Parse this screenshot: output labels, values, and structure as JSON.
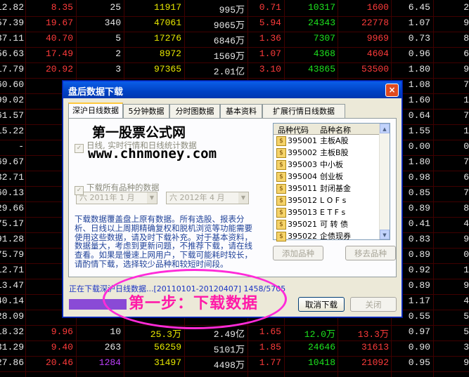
{
  "colors": {
    "red": "#ff3b3b",
    "green": "#1ee31e",
    "yellow": "#e8e800",
    "white": "#e8e8e8",
    "purple": "#c040ff"
  },
  "table_rows": [
    [
      "12.82",
      "8.35",
      "25",
      "11917",
      "995万",
      "0.71",
      "10317",
      "1600",
      "6.45",
      "2"
    ],
    [
      "57.39",
      "19.67",
      "340",
      "47061",
      "9065万",
      "5.94",
      "24343",
      "22778",
      "1.07",
      "9"
    ],
    [
      "37.11",
      "40.70",
      "5",
      "17276",
      "6846万",
      "1.36",
      "7307",
      "9969",
      "0.73",
      "8"
    ],
    [
      "56.63",
      "17.49",
      "2",
      "8972",
      "1569万",
      "1.07",
      "4368",
      "4604",
      "0.96",
      "6"
    ],
    [
      "17.79",
      "20.92",
      "3",
      "97365",
      "2.01亿",
      "3.10",
      "43865",
      "53500",
      "1.80",
      "9"
    ],
    [
      "60.60",
      "",
      "",
      "",
      "",
      "",
      "",
      "",
      "1.08",
      "7"
    ],
    [
      "99.02",
      "",
      "",
      "",
      "",
      "",
      "",
      "",
      "1.60",
      "1"
    ],
    [
      "61.57",
      "",
      "",
      "",
      "",
      "",
      "",
      "",
      "0.64",
      "7"
    ],
    [
      "15.22",
      "",
      "",
      "",
      "",
      "",
      "",
      "",
      "1.55",
      "1"
    ],
    [
      "-",
      "",
      "",
      "",
      "",
      "",
      "",
      "",
      "0.00",
      "0"
    ],
    [
      "69.67",
      "",
      "",
      "",
      "",
      "",
      "",
      "",
      "1.80",
      "7"
    ],
    [
      "32.71",
      "",
      "",
      "",
      "",
      "",
      "",
      "",
      "0.98",
      "6"
    ],
    [
      "60.13",
      "",
      "",
      "",
      "",
      "",
      "",
      "",
      "0.85",
      "7"
    ],
    [
      "29.66",
      "",
      "",
      "",
      "",
      "",
      "",
      "",
      "0.89",
      "8"
    ],
    [
      "75.17",
      "",
      "",
      "",
      "",
      "",
      "",
      "",
      "0.41",
      "4"
    ],
    [
      "91.28",
      "",
      "",
      "",
      "",
      "",
      "",
      "",
      "0.83",
      "9"
    ],
    [
      "75.79",
      "",
      "",
      "",
      "",
      "",
      "",
      "",
      "0.89",
      "0"
    ],
    [
      "12.71",
      "",
      "",
      "",
      "",
      "",
      "",
      "",
      "0.92",
      "1"
    ],
    [
      "13.47",
      "",
      "",
      "",
      "",
      "",
      "",
      "",
      "0.89",
      "9"
    ],
    [
      "40.14",
      "",
      "",
      "",
      "",
      "",
      "",
      "",
      "1.17",
      "4"
    ],
    [
      "28.09",
      "",
      "",
      "",
      "",
      "",
      "",
      "",
      "0.55",
      "5"
    ],
    [
      "18.32",
      "9.96",
      "10",
      "25.3万",
      "2.49亿",
      "1.65",
      "12.0万",
      "13.3万",
      "0.97",
      "5"
    ],
    [
      "31.29",
      "9.40",
      "263",
      "56259",
      "5101万",
      "1.85",
      "24646",
      "31613",
      "0.90",
      "3"
    ],
    [
      "27.86",
      "20.46",
      "1284",
      "31497",
      "4498万",
      "1.77",
      "10418",
      "21092",
      "0.95",
      "9"
    ]
  ],
  "dialog": {
    "title": "盘后数据下载",
    "close_label": "×",
    "tabs": [
      "深沪日线数据",
      "5分钟数据",
      "分时图数据",
      "基本资料",
      "扩展行情日线数据"
    ],
    "checkbox1_label": "日线, 实时行情和日线统计数据",
    "date_from": "六 2011年 1 月",
    "date_to": "六 2012年 4 月",
    "checkbox2_label": "下载所有品种的数据",
    "description": "下载数据覆盖盘上原有数据。所有选股、报表分析、日线以上周期精确复权和脱机浏览等功能需要使用这些数据，请及时下载补充。对于基本资料，数据量大，考虑到更新问题，不推荐下载，请在线查看。如果是慢速上网用户，下载可能耗时较长，请酌情下载，选择较少品种和较短时间段。",
    "list_header_code": "品种代码",
    "list_header_name": "品种名称",
    "list_items": [
      {
        "code": "395001",
        "name": "主板A股"
      },
      {
        "code": "395002",
        "name": "主板B股"
      },
      {
        "code": "395003",
        "name": "中小板"
      },
      {
        "code": "395004",
        "name": "创业板"
      },
      {
        "code": "395011",
        "name": "封闭基金"
      },
      {
        "code": "395012",
        "name": "L O F s"
      },
      {
        "code": "395013",
        "name": "E T F s"
      },
      {
        "code": "395021",
        "name": "可 转 债"
      },
      {
        "code": "395022",
        "name": "企债现券"
      }
    ],
    "add_button": "添加品种",
    "remove_button": "移去品种",
    "status_text": "正在下载深沪日线数据...[20110101-20120407] 1458/5705",
    "progress": 0.2556,
    "cancel_button": "取消下载",
    "close_button": "关闭"
  },
  "watermark_line1": "第一股票公式网",
  "watermark_line2": "www.chnmoney.com",
  "callout_text": "第一步：下载数据"
}
